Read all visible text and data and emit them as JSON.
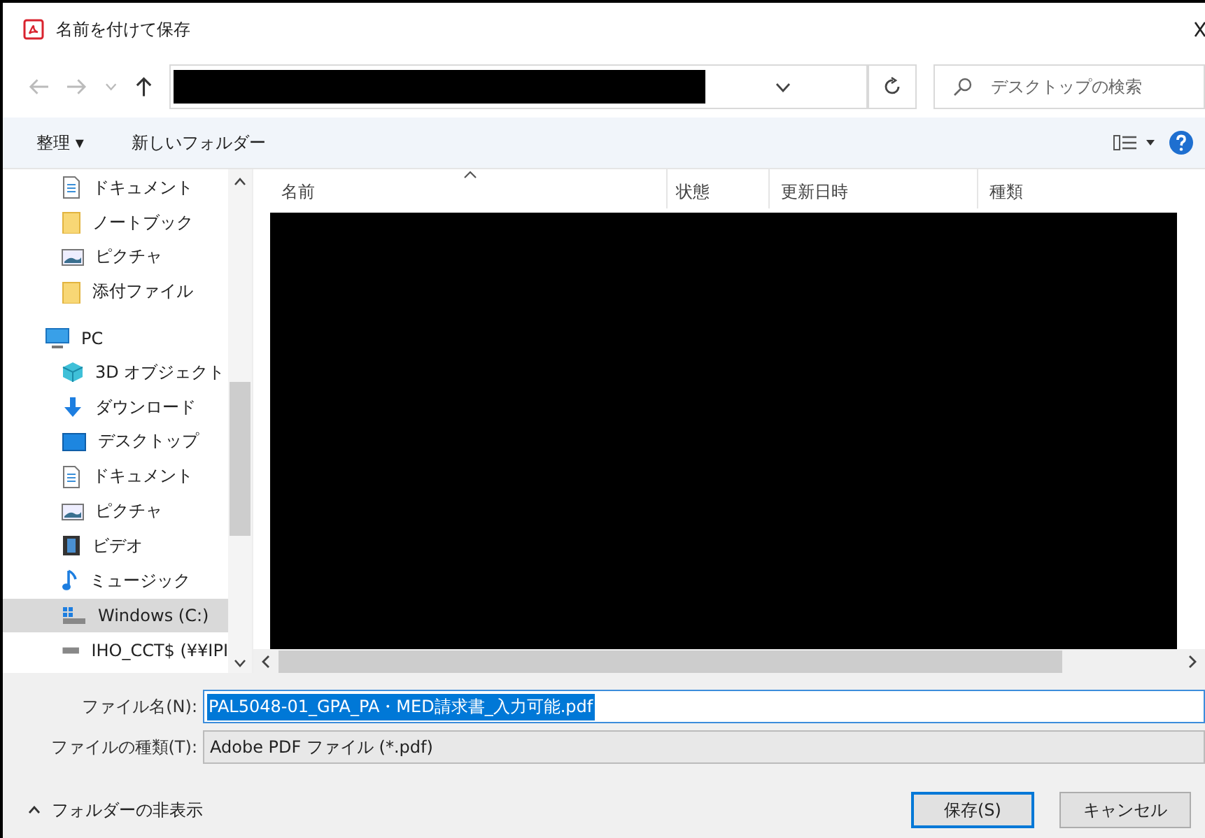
{
  "window": {
    "title": "名前を付けて保存"
  },
  "search": {
    "placeholder": "デスクトップの検索"
  },
  "toolbar": {
    "organize": "整理 ▾",
    "new_folder": "新しいフォルダー"
  },
  "sidebar": {
    "items": [
      {
        "label": "ドキュメント",
        "kind": "document",
        "selected": false
      },
      {
        "label": "ノートブック",
        "kind": "folder",
        "selected": false
      },
      {
        "label": "ピクチャ",
        "kind": "picture",
        "selected": false
      },
      {
        "label": "添付ファイル",
        "kind": "folder",
        "selected": false
      },
      {
        "label": "PC",
        "kind": "pc",
        "selected": false,
        "children": [
          {
            "label": "3D オブジェクト",
            "kind": "cube",
            "selected": false
          },
          {
            "label": "ダウンロード",
            "kind": "download",
            "selected": false
          },
          {
            "label": "デスクトップ",
            "kind": "desktop",
            "selected": false
          },
          {
            "label": "ドキュメント",
            "kind": "document",
            "selected": false
          },
          {
            "label": "ピクチャ",
            "kind": "picture",
            "selected": false
          },
          {
            "label": "ビデオ",
            "kind": "video",
            "selected": false
          },
          {
            "label": "ミュージック",
            "kind": "music",
            "selected": false
          },
          {
            "label": "Windows (C:)",
            "kind": "drive",
            "selected": true
          },
          {
            "label": "IHO_CCT$ (¥¥IPI",
            "kind": "netdrive",
            "selected": false
          }
        ]
      }
    ]
  },
  "table": {
    "columns": [
      "名前",
      "状態",
      "更新日時",
      "種類"
    ]
  },
  "filename": {
    "label": "ファイル名(N):",
    "value": "PAL5048-01_GPA_PA・MED請求書_入力可能.pdf",
    "selected": true
  },
  "filetype": {
    "label": "ファイルの種類(T):",
    "value": "Adobe PDF ファイル (*.pdf)"
  },
  "hide_folders": "フォルダーの非表示",
  "buttons": [
    {
      "label": "保存(S)",
      "kind": "default"
    },
    {
      "label": "キャンセル",
      "kind": "normal"
    }
  ]
}
